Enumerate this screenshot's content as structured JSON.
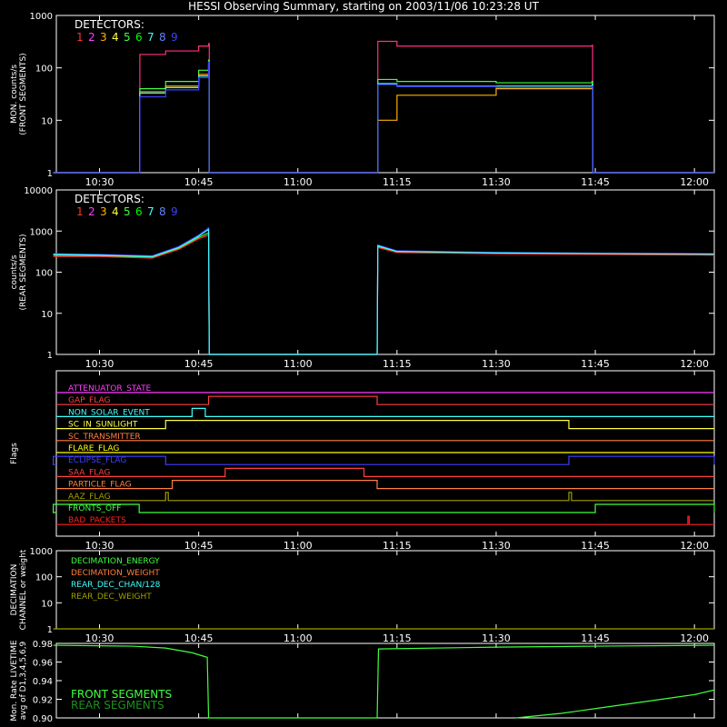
{
  "title": "HESSI Observing Summary, starting on 2003/11/06 10:23:28 UT",
  "time_ticks": [
    "10:30",
    "10:45",
    "11:00",
    "11:15",
    "11:30",
    "11:45",
    "12:00"
  ],
  "detector_colors": [
    "#ff3030",
    "#ff40ff",
    "#ffb000",
    "#ffff40",
    "#40ff40",
    "#00ff00",
    "#40ffff",
    "#6080ff",
    "#4040ff"
  ],
  "detector_labels": [
    "1",
    "2",
    "3",
    "4",
    "5",
    "6",
    "7",
    "8",
    "9"
  ],
  "chart_data": [
    {
      "type": "line",
      "panel": "front",
      "legend_title": "DETECTORS:",
      "ylabel": "MON. counts/s (FRONT SEGMENTS)",
      "yscale": "log",
      "ylim": [
        1,
        1000
      ],
      "ytick_labels": [
        "1",
        "10",
        "100",
        "1000"
      ],
      "xlim": [
        "10:23:28",
        "12:03"
      ],
      "series": [
        {
          "color": "#ff3080",
          "x": [
            "10:23",
            "10:36",
            "10:36.1",
            "10:40",
            "10:45",
            "10:46.5",
            "10:46.6",
            "11:12",
            "11:12.1",
            "11:15",
            "11:30",
            "11:44.5",
            "11:44.6",
            "12:03"
          ],
          "y": [
            1,
            1,
            180,
            210,
            260,
            290,
            1,
            1,
            320,
            260,
            260,
            270,
            1,
            1
          ]
        },
        {
          "color": "#40ff40",
          "x": [
            "10:23",
            "10:36",
            "10:36.1",
            "10:40",
            "10:45",
            "10:46.5",
            "10:46.6",
            "11:12",
            "11:12.1",
            "11:15",
            "11:30",
            "11:44.5",
            "11:44.6",
            "12:03"
          ],
          "y": [
            1,
            1,
            40,
            55,
            90,
            140,
            1,
            1,
            60,
            55,
            52,
            55,
            1,
            1
          ]
        },
        {
          "color": "#ffb000",
          "x": [
            "10:23",
            "10:36",
            "10:36.1",
            "10:40",
            "10:45",
            "10:46.5",
            "10:46.6",
            "11:12",
            "11:12.1",
            "11:15",
            "11:30",
            "11:44.5",
            "11:44.6",
            "12:03"
          ],
          "y": [
            1,
            1,
            35,
            45,
            75,
            110,
            1,
            1,
            10,
            30,
            40,
            42,
            1,
            1
          ]
        },
        {
          "color": "#40ffff",
          "x": [
            "10:23",
            "10:36",
            "10:36.1",
            "10:40",
            "10:45",
            "10:46.5",
            "10:46.6",
            "11:12",
            "11:12.1",
            "11:15",
            "11:30",
            "11:44.5",
            "11:44.6",
            "12:03"
          ],
          "y": [
            1,
            1,
            33,
            42,
            70,
            120,
            1,
            1,
            50,
            45,
            45,
            48,
            1,
            1
          ]
        },
        {
          "color": "#4040ff",
          "x": [
            "10:23",
            "10:36",
            "10:36.1",
            "10:40",
            "10:45",
            "10:46.5",
            "10:46.6",
            "11:12",
            "11:12.1",
            "11:15",
            "11:30",
            "11:44.5",
            "11:44.6",
            "12:03"
          ],
          "y": [
            1,
            1,
            28,
            38,
            65,
            130,
            1,
            1,
            48,
            44,
            42,
            45,
            1,
            1
          ]
        }
      ]
    },
    {
      "type": "line",
      "panel": "rear",
      "legend_title": "DETECTORS:",
      "ylabel": "counts/s (REAR SEGMENTS)",
      "yscale": "log",
      "ylim": [
        1,
        10000
      ],
      "ytick_labels": [
        "1",
        "10",
        "100",
        "1000",
        "10000"
      ],
      "xlim": [
        "10:23:28",
        "12:03"
      ],
      "series": [
        {
          "color": "#40ff40",
          "x": [
            "10:23",
            "10:30",
            "10:38",
            "10:42",
            "10:45",
            "10:46.5",
            "10:46.6",
            "11:12",
            "11:12.1",
            "11:15",
            "11:30",
            "11:45",
            "12:03"
          ],
          "y": [
            260,
            250,
            230,
            380,
            700,
            900,
            1,
            1,
            420,
            310,
            290,
            280,
            270
          ]
        },
        {
          "color": "#ff3030",
          "x": [
            "10:23",
            "10:30",
            "10:38",
            "10:42",
            "10:45",
            "10:46.5",
            "10:46.6",
            "11:12",
            "11:12.1",
            "11:15",
            "11:30",
            "11:45",
            "12:03"
          ],
          "y": [
            240,
            240,
            220,
            360,
            650,
            800,
            1,
            1,
            400,
            300,
            280,
            270,
            260
          ]
        },
        {
          "color": "#4040ff",
          "x": [
            "10:23",
            "10:30",
            "10:38",
            "10:42",
            "10:45",
            "10:46.5",
            "10:46.6",
            "11:12",
            "11:12.1",
            "11:15",
            "11:30",
            "11:45",
            "12:03"
          ],
          "y": [
            280,
            270,
            250,
            420,
            800,
            1200,
            1,
            1,
            460,
            330,
            300,
            290,
            280
          ]
        },
        {
          "color": "#40ffff",
          "x": [
            "10:23",
            "10:30",
            "10:38",
            "10:42",
            "10:45",
            "10:46.5",
            "10:46.6",
            "11:12",
            "11:12.1",
            "11:15",
            "11:30",
            "11:45",
            "12:03"
          ],
          "y": [
            270,
            260,
            240,
            400,
            750,
            1100,
            1,
            1,
            440,
            320,
            295,
            285,
            275
          ]
        }
      ]
    },
    {
      "type": "step",
      "panel": "flags",
      "ylabel": "Flags",
      "xlim": [
        "10:23:28",
        "12:03"
      ],
      "flags": [
        {
          "name": "ATTENUATOR_STATE",
          "color": "#ff40ff",
          "on": []
        },
        {
          "name": "GAP_FLAG",
          "color": "#ff4040",
          "on": [
            [
              "10:46.5",
              "11:12"
            ]
          ]
        },
        {
          "name": "NON_SOLAR_EVENT",
          "color": "#40ffff",
          "on": [
            [
              "10:44",
              "10:46"
            ]
          ]
        },
        {
          "name": "SC_IN_SUNLIGHT",
          "color": "#ffff40",
          "on": [
            [
              "10:40",
              "11:41"
            ]
          ]
        },
        {
          "name": "SC_TRANSMITTER",
          "color": "#ff8040",
          "on": []
        },
        {
          "name": "FLARE_FLAG",
          "color": "#ffff00",
          "on": []
        },
        {
          "name": "ECLIPSE_FLAG",
          "color": "#4040ff",
          "on": [
            [
              "10:23",
              "10:40"
            ],
            [
              "11:41",
              "12:03"
            ]
          ]
        },
        {
          "name": "SAA_FLAG",
          "color": "#ff4040",
          "on": [
            [
              "10:49",
              "11:10"
            ]
          ]
        },
        {
          "name": "PARTICLE_FLAG",
          "color": "#ff8040",
          "on": [
            [
              "10:41",
              "11:12"
            ]
          ]
        },
        {
          "name": "AAZ_FLAG",
          "color": "#a0a000",
          "on": [
            [
              "10:40",
              "10:40.4"
            ],
            [
              "11:41",
              "11:41.4"
            ]
          ]
        },
        {
          "name": "FRONTS_OFF",
          "color": "#40ff40",
          "on": [
            [
              "10:23",
              "10:36"
            ],
            [
              "11:45",
              "12:03"
            ]
          ]
        },
        {
          "name": "BAD_PACKETS",
          "color": "#ff2020",
          "on": [
            [
              "11:59",
              "11:59.2"
            ]
          ]
        }
      ]
    },
    {
      "type": "line",
      "panel": "decimation",
      "ylabel": "DECIMATION CHANNEL or weight",
      "yscale": "log",
      "ylim": [
        1,
        1000
      ],
      "ytick_labels": [
        "1",
        "10",
        "100",
        "1000"
      ],
      "xlim": [
        "10:23:28",
        "12:03"
      ],
      "legend": [
        {
          "name": "DECIMATION_ENERGY",
          "color": "#40ff40"
        },
        {
          "name": "DECIMATION_WEIGHT",
          "color": "#ff8040"
        },
        {
          "name": "REAR_DEC_CHAN/128",
          "color": "#40ffff"
        },
        {
          "name": "REAR_DEC_WEIGHT",
          "color": "#a0a000"
        }
      ],
      "series": [
        {
          "color": "#a0a000",
          "x": [
            "10:23",
            "12:03"
          ],
          "y": [
            1,
            1
          ]
        }
      ]
    },
    {
      "type": "line",
      "panel": "livetime",
      "ylabel": "Mon. Rate LIVETIME avg of D1,3,4,5,6,9",
      "ylim": [
        0.9,
        0.98
      ],
      "ytick_labels": [
        "0.90",
        "0.92",
        "0.94",
        "0.96",
        "0.98"
      ],
      "xlim": [
        "10:23:28",
        "12:03"
      ],
      "legend": [
        {
          "name": "FRONT SEGMENTS",
          "color": "#40ff40"
        },
        {
          "name": "REAR SEGMENTS",
          "color": "#1f8f1f"
        }
      ],
      "series": [
        {
          "color": "#40ff40",
          "x": [
            "10:23",
            "10:35",
            "10:40",
            "10:44",
            "10:46.3",
            "10:46.5",
            "11:12",
            "11:12.2",
            "11:30",
            "11:45",
            "12:03"
          ],
          "y": [
            0.978,
            0.977,
            0.975,
            0.97,
            0.965,
            0.9,
            0.9,
            0.974,
            0.976,
            0.977,
            0.978
          ]
        },
        {
          "color": "#40ff40",
          "x": [
            "11:33",
            "11:40",
            "11:45",
            "11:50",
            "11:55",
            "12:00",
            "12:03"
          ],
          "y": [
            0.9,
            0.905,
            0.91,
            0.915,
            0.92,
            0.925,
            0.93
          ]
        }
      ]
    }
  ]
}
